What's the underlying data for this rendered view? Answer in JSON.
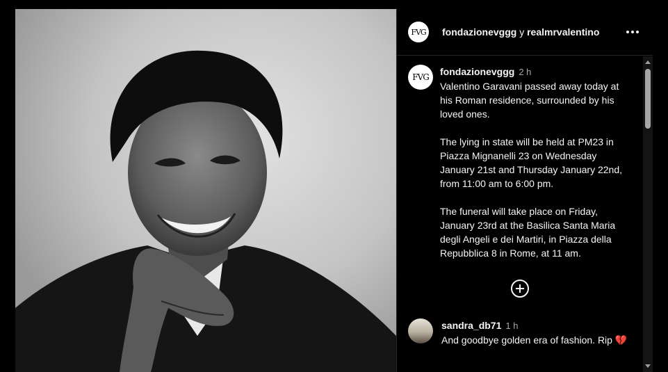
{
  "header": {
    "avatar_text": "FVG",
    "user1": "fondazionevggg",
    "separator": "y",
    "user2": "realmrvalentino"
  },
  "post": {
    "avatar_text": "FVG",
    "username": "fondazionevggg",
    "time": "2 h",
    "paragraphs": [
      "Valentino Garavani passed away today at his Roman residence, surrounded by his loved ones.",
      "The lying in state will be held at PM23 in Piazza Mignanelli 23 on Wednesday January 21st and Thursday January 22nd, from 11:00 am to 6:00 pm.",
      "The funeral will take place on Friday, January 23rd at the Basilica Santa Maria degli Angeli e dei Martiri, in Piazza della Repubblica 8 in Rome, at 11 am."
    ]
  },
  "comments": [
    {
      "username": "sandra_db71",
      "time": "1 h",
      "text": "And goodbye golden era of fashion. Rip",
      "emoji": "💔"
    }
  ],
  "icons": {
    "more": "more-horizontal-icon",
    "load_more": "plus-circle-icon",
    "broken_heart": "broken-heart-icon"
  },
  "colors": {
    "background": "#000000",
    "text": "#f5f5f5",
    "muted": "#a8a8a8",
    "heart": "#d1243a"
  }
}
